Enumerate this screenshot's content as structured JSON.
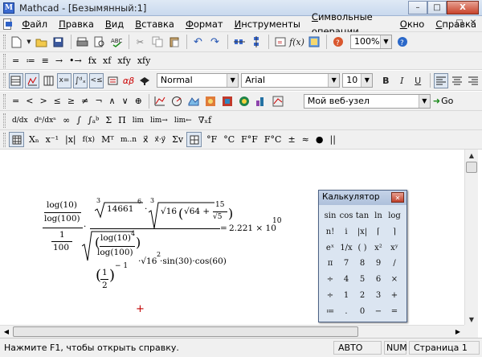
{
  "window": {
    "title": "Mathcad - [Безымянный:1]",
    "controls": [
      "–",
      "□",
      "X"
    ]
  },
  "menubar": {
    "items": [
      "Файл",
      "Правка",
      "Вид",
      "Вставка",
      "Формат",
      "Инструменты",
      "Символьные операции",
      "Окно",
      "Справка"
    ],
    "mdi_controls": [
      "–",
      "□",
      "✕"
    ]
  },
  "standard_toolbar": {
    "zoom": "100%"
  },
  "math_toolbar": {
    "buttons": [
      "=",
      "≔",
      "≡",
      "→",
      "•→",
      "fx",
      "xf",
      "xfy",
      "xfy"
    ]
  },
  "formatting_toolbar": {
    "style": "Normal",
    "font": "Arial",
    "size": "10",
    "bold": "B",
    "italic": "I",
    "underline": "U"
  },
  "boolean_toolbar": {
    "buttons": [
      "=",
      "<",
      ">",
      "≤",
      "≥",
      "≠",
      "¬",
      "∧",
      "∨",
      "⊕"
    ],
    "web_location": "Мой веб-узел",
    "go_label": "Go"
  },
  "calculus_toolbar": {
    "buttons": [
      "d/dx",
      "dⁿ/dxⁿ",
      "∞",
      "∫",
      "∫ₐᵇ",
      "Σ",
      "Π",
      "lim",
      "lim→",
      "lim←",
      "∇ₓf"
    ]
  },
  "evaluation_toolbar": {
    "buttons": [
      "Xₙ",
      "x⁻¹",
      "|x|",
      "f(x)",
      "Mᵀ",
      "m..n",
      "x⃗",
      "x⃗·y⃗",
      "Σv"
    ],
    "units": [
      "°F",
      "°C",
      "F°F",
      "F°C",
      "±",
      "≈",
      "●",
      "||"
    ]
  },
  "worksheet": {
    "expression": {
      "frac1_num": "log(10)",
      "frac1_den": "log(100)",
      "frac2_num": "1",
      "frac2_den": "100",
      "root3_index": "3",
      "root3_radicand": "14661",
      "root3_exp": "6",
      "root4_index": "3",
      "sqrt16": "√16",
      "sqrt64": "√64 + ",
      "frac15_num": "15",
      "frac15_den": "√5",
      "den_frac_num": "log(10)",
      "den_frac_den": "log(100)",
      "den_exp": "4",
      "half_num": "1",
      "half_den": "2",
      "neg_one": "− 1",
      "sqrt16_sq": "·√16",
      "sq_exp": "2",
      "trig": "·sin(30)·cos(60)",
      "equals": "=",
      "result": "2.221 × 10",
      "result_exp": "10"
    }
  },
  "calculator": {
    "title": "Калькулятор",
    "keys": [
      "sin",
      "cos",
      "tan",
      "ln",
      "log",
      "n!",
      "i",
      "|x|",
      "⌈",
      "⌉",
      "eˣ",
      "1/x",
      "( )",
      "x²",
      "xʸ",
      "π",
      "7",
      "8",
      "9",
      "/",
      "÷",
      "4",
      "5",
      "6",
      "×",
      "÷",
      "1",
      "2",
      "3",
      "+",
      "≔",
      ".",
      "0",
      "−",
      "="
    ]
  },
  "statusbar": {
    "message": "Нажмите F1, чтобы открыть справку.",
    "auto": "АВТО",
    "num": "NUM",
    "page": "Страница 1"
  }
}
